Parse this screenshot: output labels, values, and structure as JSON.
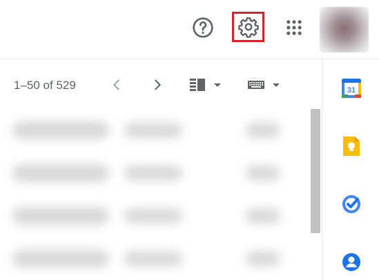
{
  "header": {
    "help_icon": "help-icon",
    "settings_icon": "gear-icon",
    "apps_icon": "apps-grid-icon",
    "highlight_color": "#d9212c"
  },
  "toolbar": {
    "page_count": "1–50 of 529",
    "prev_icon": "chevron-left-icon",
    "next_icon": "chevron-right-icon",
    "split_pane_icon": "split-pane-icon",
    "input_tools_icon": "keyboard-icon"
  },
  "side_panel": {
    "calendar_day": "31",
    "icons": [
      "calendar-icon",
      "keep-icon",
      "tasks-icon",
      "contacts-icon"
    ],
    "colors": {
      "blue": "#4285f4",
      "yellow": "#fbbc04",
      "green": "#34a853",
      "red": "#ea4335"
    }
  }
}
